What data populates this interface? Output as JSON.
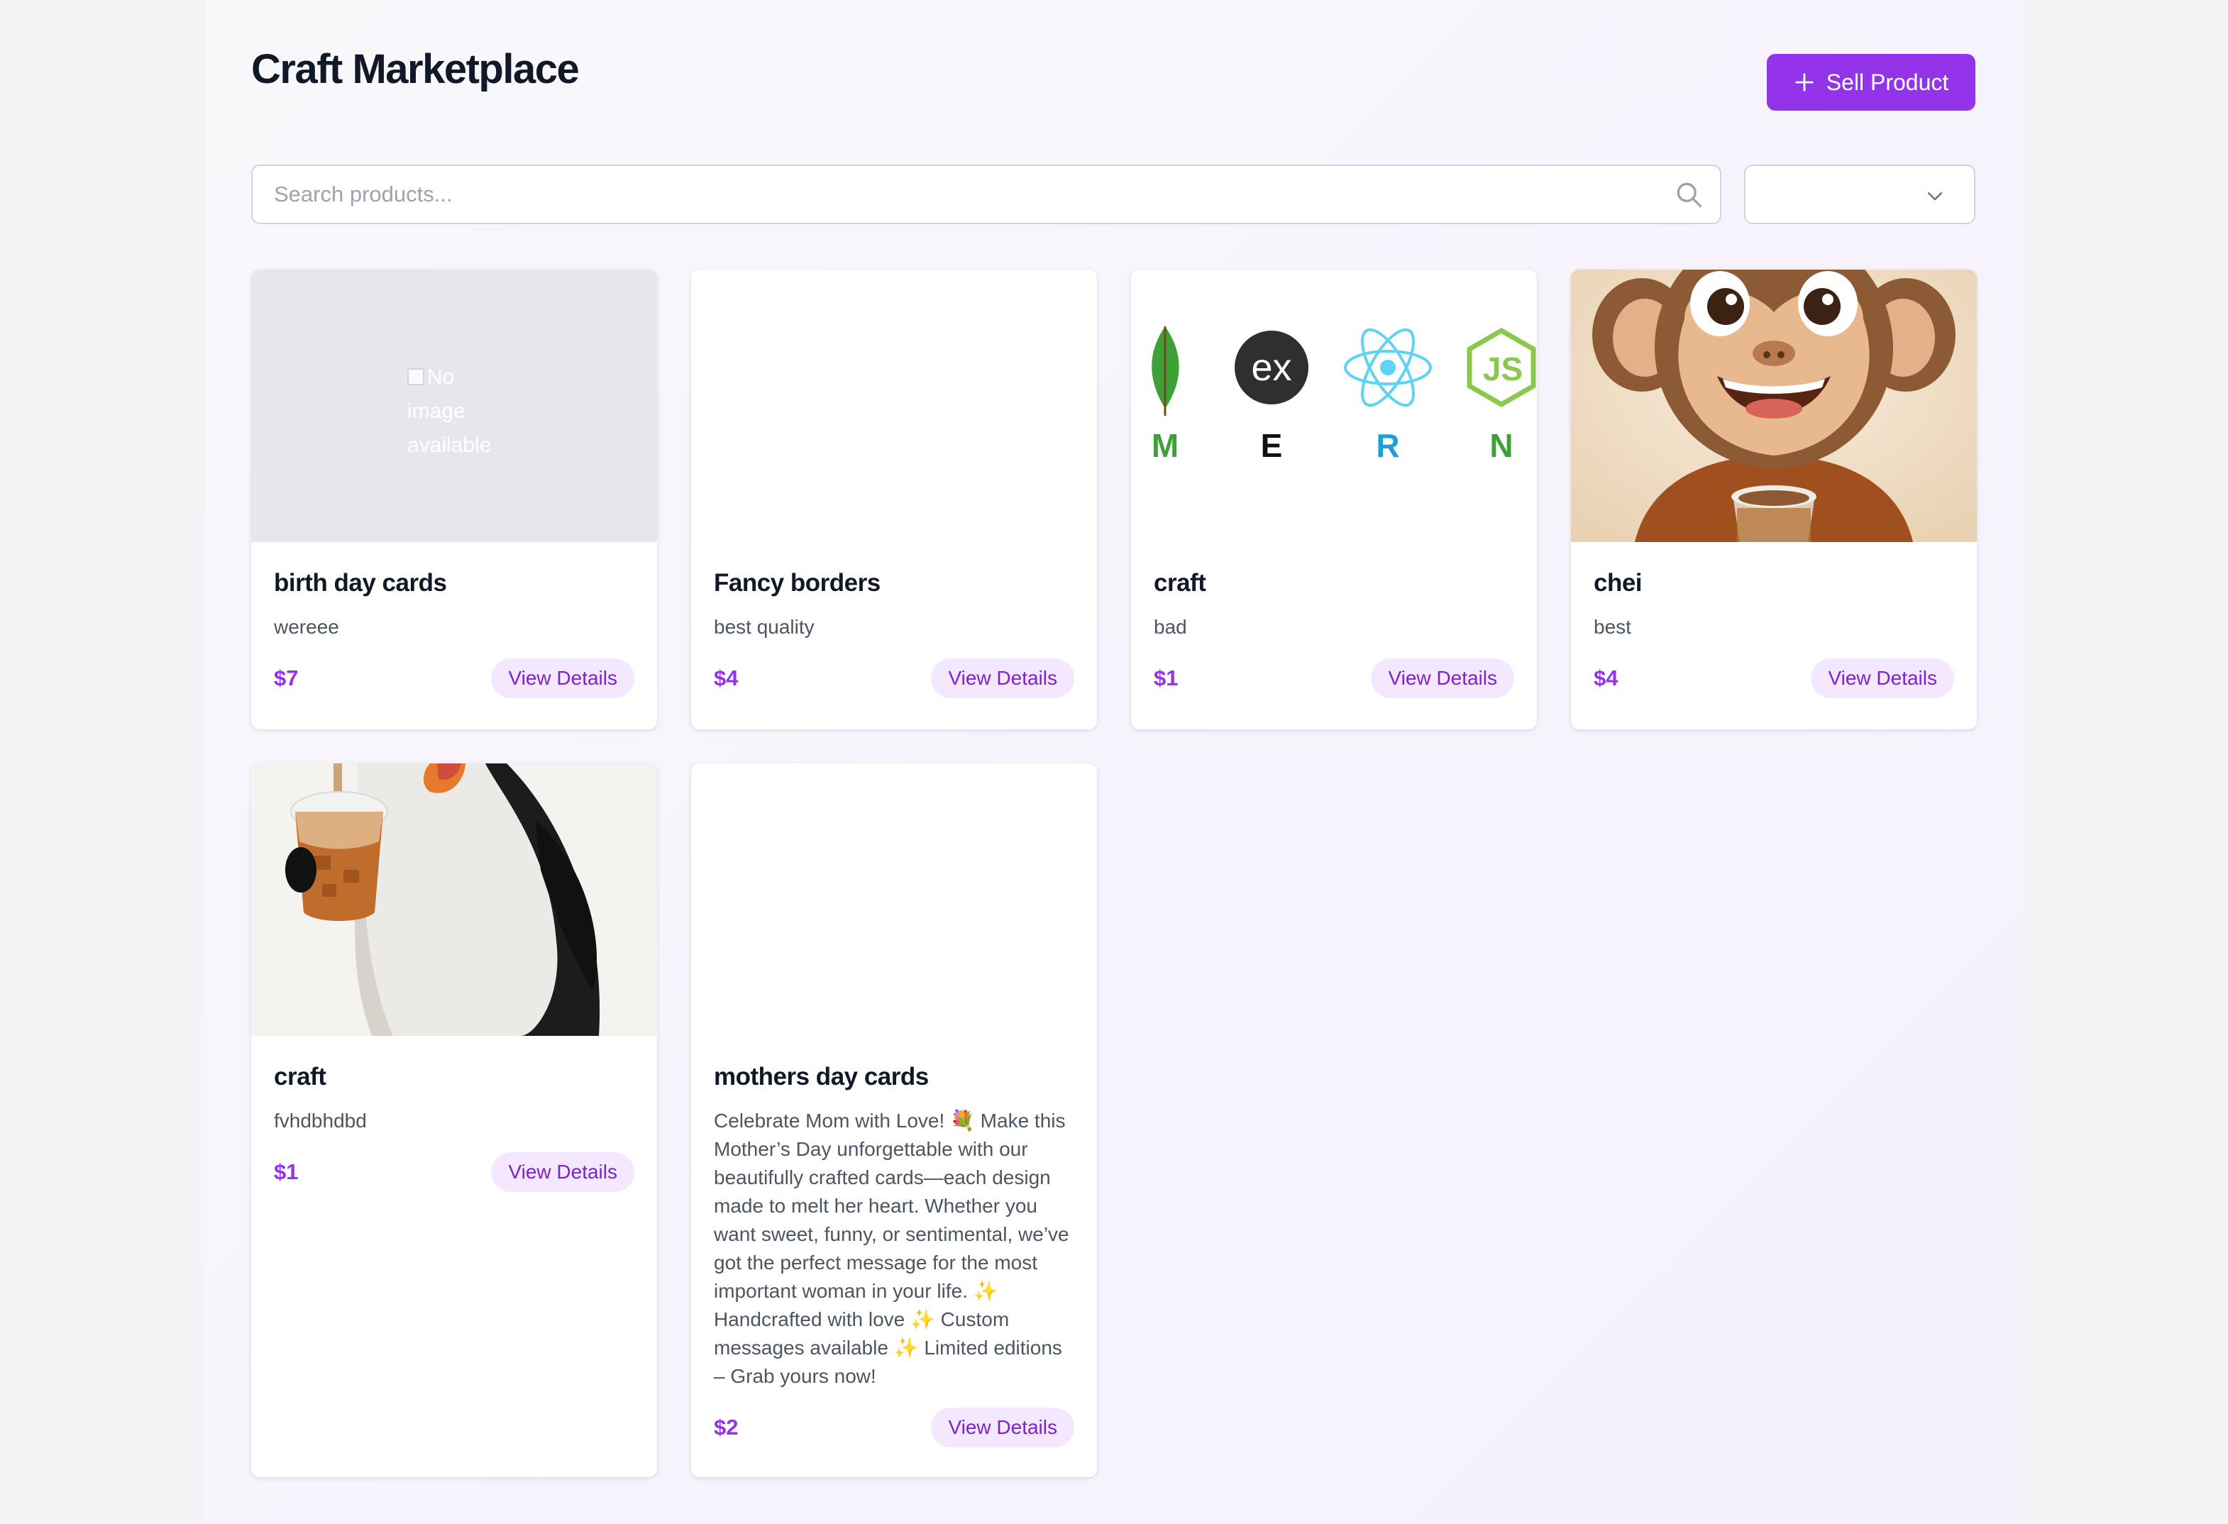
{
  "header": {
    "title": "Craft Marketplace",
    "sell_button_label": "Sell Product"
  },
  "search": {
    "placeholder": "Search products...",
    "value": ""
  },
  "filter_select": {
    "selected": ""
  },
  "products": [
    {
      "title": "birth day cards",
      "description": "wereee",
      "price": "$7",
      "button_label": "View Details",
      "image": "broken-image",
      "image_alt": "No image available"
    },
    {
      "title": "Fancy borders",
      "description": "best quality",
      "price": "$4",
      "button_label": "View Details",
      "image": "blank"
    },
    {
      "title": "craft",
      "description": "bad",
      "price": "$1",
      "button_label": "View Details",
      "image": "mern-stack-logos",
      "image_letters": [
        "M",
        "E",
        "R",
        "N"
      ],
      "image_logo_text": {
        "express": "ex",
        "node": "JS"
      }
    },
    {
      "title": "chei",
      "description": "best",
      "price": "$4",
      "button_label": "View Details",
      "image": "cartoon-monkey-with-coffee"
    },
    {
      "title": "craft",
      "description": "fvhdbhdbd",
      "price": "$1",
      "button_label": "View Details",
      "image": "penguin-with-iced-coffee"
    },
    {
      "title": "mothers day cards",
      "description": "Celebrate Mom with Love! 💐 Make this Mother’s Day unforgettable with our beautifully crafted cards—each design made to melt her heart. Whether you want sweet, funny, or sentimental, we’ve got the perfect message for the most important woman in your life. ✨ Handcrafted with love ✨ Custom messages available ✨ Limited editions – Grab yours now!",
      "price": "$2",
      "button_label": "View Details",
      "image": "blank"
    }
  ],
  "colors": {
    "accent": "#9333ea",
    "accent_soft": "#f3e8ff",
    "accent_text": "#7e22ce"
  }
}
